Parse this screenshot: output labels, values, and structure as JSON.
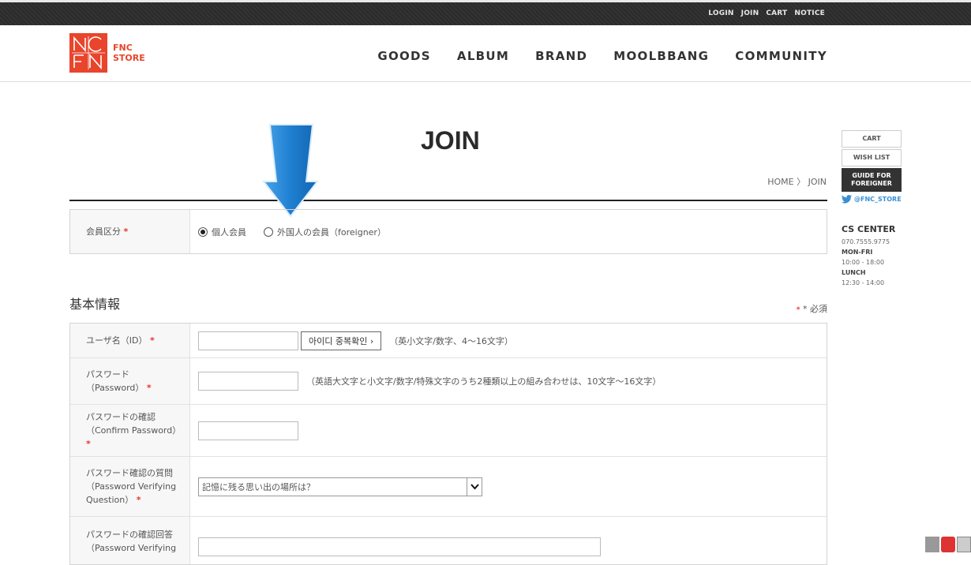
{
  "topbar": {
    "links": [
      "LOGIN",
      "JOIN",
      "CART",
      "NOTICE"
    ]
  },
  "logo": {
    "line1": "FNC",
    "line2": "STORE",
    "brand_color": "#e8452c"
  },
  "nav": [
    "GOODS",
    "ALBUM",
    "BRAND",
    "MOOLBBANG",
    "COMMUNITY"
  ],
  "page": {
    "title": "JOIN",
    "breadcrumb": "HOME 〉 JOIN"
  },
  "member_type": {
    "label": "会員区分",
    "star": "*",
    "options": [
      {
        "label": "個人会員",
        "selected": true
      },
      {
        "label": "外国人の会員（foreigner）",
        "selected": false
      }
    ]
  },
  "basic": {
    "heading": "基本情報",
    "required_note": "* 必須"
  },
  "fields": {
    "id": {
      "label": "ユーザ名（ID）",
      "star": "*",
      "value": "",
      "check_button": "아이디 중복확인 ›",
      "hint": "（英小文字/数字、4〜16文字）"
    },
    "password": {
      "label1": "パスワード",
      "label2": "（Password）",
      "star": "*",
      "value": "",
      "hint": "（英語大文字と小文字/数字/特殊文字のうち2種類以上の組み合わせは、10文字〜16文字）"
    },
    "confirm": {
      "label1": "パスワードの確認",
      "label2": "（Confirm Password）",
      "star": "*",
      "value": ""
    },
    "question": {
      "label1": "パスワード確認の質問",
      "label2": "（Password Verifying",
      "label3": "Question）",
      "star": "*",
      "selected": "記憶に残る思い出の場所は？"
    },
    "answer": {
      "label1": "パスワードの確認回答",
      "label2": "（Password Verifying",
      "value": ""
    }
  },
  "sidebar": {
    "cart": "CART",
    "wishlist": "WISH LIST",
    "guide1": "GUIDE FOR",
    "guide2": "FOREIGNER",
    "twitter": "@FNC_STORE",
    "cs_title": "CS CENTER",
    "phone": "070.7555.9775",
    "hours_label": "MON-FRI",
    "hours": "10:00 - 18:00",
    "lunch_label": "LUNCH",
    "lunch": "12:30 - 14:00"
  },
  "colors": {
    "accent_arrow": "#1f7fd0",
    "required_star": "#ee3333"
  }
}
